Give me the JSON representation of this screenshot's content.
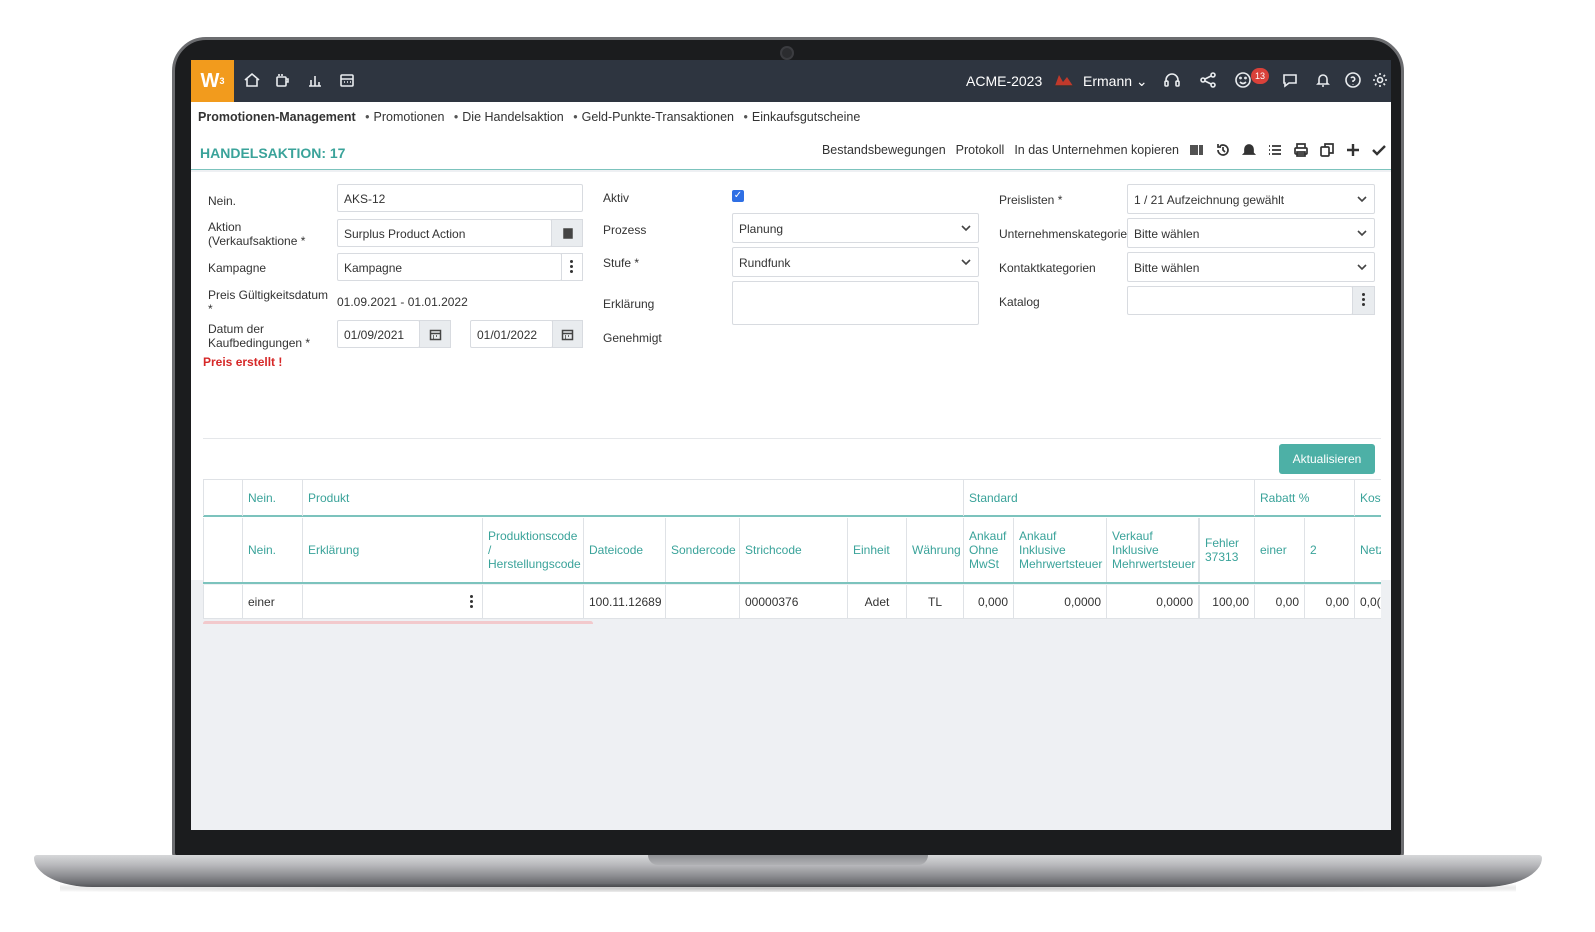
{
  "topbar": {
    "logo": "W",
    "logo_sup": "3",
    "company": "ACME-2023",
    "user": "Ermann",
    "notifications_count": "13",
    "icons": [
      "home-icon",
      "coffee-icon",
      "chart-icon",
      "calendar-icon",
      "headset-icon",
      "share-icon",
      "smiley-icon",
      "chat-icon",
      "bell-icon",
      "help-icon",
      "gear-icon"
    ]
  },
  "breadcrumb": {
    "items": [
      "Promotionen-Management",
      "Promotionen",
      "Die Handelsaktion",
      "Geld-Punkte-Transaktionen",
      "Einkaufsgutscheine"
    ]
  },
  "title": "HANDELSAKTION: 17",
  "actions": {
    "stock": "Bestandsbewegungen",
    "log": "Protokoll",
    "copy": "In das Unternehmen kopieren",
    "icons": [
      "barcode-icon",
      "history-icon",
      "bell-icon",
      "list-icon",
      "print-icon",
      "copy-icon",
      "plus-icon",
      "check-icon"
    ]
  },
  "form": {
    "no_label": "Nein.",
    "no_value": "AKS-12",
    "action_label": "Aktion (Verkaufsaktione *",
    "action_value": "Surplus Product Action",
    "campaign_label": "Kampagne",
    "campaign_value": "Kampagne",
    "price_validity_label": "Preis Gültigkeitsdatum *",
    "price_validity_value": "01.09.2021 - 01.01.2022",
    "purchase_date_label": "Datum der Kaufbedingungen *",
    "purchase_date_from": "01/09/2021",
    "purchase_date_to": "01/01/2022",
    "price_created": "Preis erstellt !",
    "active_label": "Aktiv",
    "active_checked": true,
    "process_label": "Prozess",
    "process_value": "Planung",
    "stage_label": "Stufe *",
    "stage_value": "Rundfunk",
    "explanation_label": "Erklärung",
    "approved_label": "Genehmigt",
    "pricelists_label": "Preislisten *",
    "pricelists_value": "1 / 21 Aufzeichnung gewählt",
    "company_cat_label": "Unternehmenskategorien",
    "company_cat_value": "Bitte wählen",
    "contact_cat_label": "Kontaktkategorien",
    "contact_cat_value": "Bitte wählen",
    "catalog_label": "Katalog",
    "catalog_value": "",
    "update_button": "Aktualisieren"
  },
  "table": {
    "group_headers": [
      "Nein.",
      "Produkt",
      "Standard",
      "Rabatt %",
      "Kost"
    ],
    "columns": [
      "Nein.",
      "Erklärung",
      "Produktionscode / Herstellungscode",
      "Dateicode",
      "Sondercode",
      "Strichcode",
      "Einheit",
      "Währung",
      "Ankauf Ohne MwSt",
      "Ankauf Inklusive Mehrwertsteuer",
      "Verkauf Inklusive Mehrwertsteuer",
      "Fehler 37313",
      "einer",
      "2",
      "Netz"
    ],
    "rows": [
      [
        "einer",
        "",
        "",
        "100.11.12689",
        "",
        "00000376",
        "Adet",
        "TL",
        "0,000",
        "0,0000",
        "0,0000",
        "100,00",
        "0,00",
        "0,00",
        "0,0("
      ]
    ]
  }
}
